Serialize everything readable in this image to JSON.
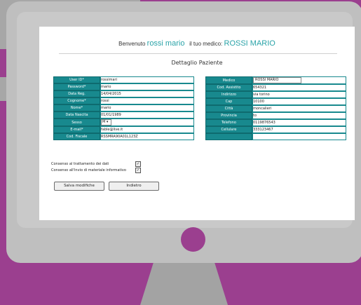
{
  "header": {
    "welcome": "Benvenuto",
    "user_name": "rossi mario",
    "medico_label": "il tuo medico:",
    "medico_name": "ROSSI MARIO"
  },
  "page_title": "Dettaglio Paziente",
  "left": [
    {
      "label": "User ID*",
      "value": "rossimari"
    },
    {
      "label": "Password*",
      "value": "mario"
    },
    {
      "label": "Data Reg.",
      "value": "14/04/2015"
    },
    {
      "label": "Cognome*",
      "value": "rossi"
    },
    {
      "label": "Nome*",
      "value": "mario"
    },
    {
      "label": "Data Nascita",
      "value": "01/01/1989"
    },
    {
      "label": "Sesso",
      "value": "M"
    },
    {
      "label": "E-mail*",
      "value": "fable@live.it"
    },
    {
      "label": "Cod. Fiscale",
      "value": "RSSMRA90A01L123Z"
    }
  ],
  "right": [
    {
      "label": "Medico",
      "value": "ROSSI MARIO"
    },
    {
      "label": "Cod. Assistito",
      "value": "654321"
    },
    {
      "label": "Indirizzo",
      "value": "via torino"
    },
    {
      "label": "Cap",
      "value": "10100"
    },
    {
      "label": "Città",
      "value": "moncalieri"
    },
    {
      "label": "Provincia",
      "value": "to"
    },
    {
      "label": "Telefono",
      "value": "0119876543"
    },
    {
      "label": "Cellulare",
      "value": "333123467"
    },
    {
      "label": "",
      "value": ""
    }
  ],
  "consent": {
    "trattamento": "Consenso al trattamento dei dati",
    "invio": "Consenso all'invio di materiale informativo"
  },
  "buttons": {
    "save": "Salva modifiche",
    "back": "Indietro"
  },
  "colors": {
    "accent": "#18898e",
    "frame": "#9b3f8f"
  }
}
